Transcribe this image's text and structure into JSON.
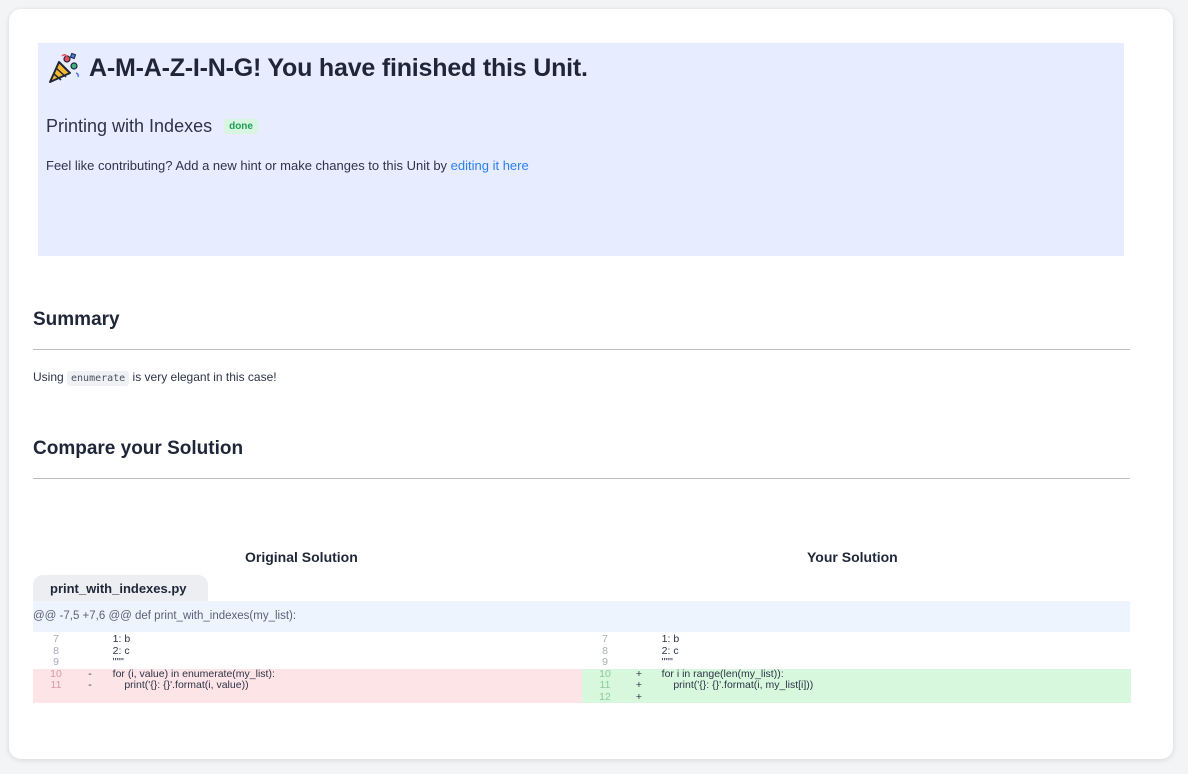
{
  "banner": {
    "title": "A-M-A-Z-I-N-G! You have finished this Unit.",
    "unit_name": "Printing with Indexes",
    "status_badge": "done",
    "contrib_text": "Feel like contributing? Add a new hint or make changes to this Unit by ",
    "contrib_link": "editing it here"
  },
  "summary": {
    "heading": "Summary",
    "text_before": "Using ",
    "code": "enumerate",
    "text_after": " is very elegant in this case!"
  },
  "compare": {
    "heading": "Compare your Solution",
    "original_heading": "Original Solution",
    "yours_heading": "Your Solution",
    "file_name": "print_with_indexes.py",
    "hunk_header": "@@ -7,5 +7,6 @@ def print_with_indexes(my_list):",
    "left_lines": [
      {
        "ln": "7",
        "sign": "",
        "code": "    1: b",
        "type": "ctx"
      },
      {
        "ln": "8",
        "sign": "",
        "code": "    2: c",
        "type": "ctx"
      },
      {
        "ln": "9",
        "sign": "",
        "code": "    \"\"\"",
        "type": "ctx"
      },
      {
        "ln": "10",
        "sign": "-",
        "code": "    for (i, value) in enumerate(my_list):",
        "type": "del"
      },
      {
        "ln": "11",
        "sign": "-",
        "code": "        print('{}: {}'.format(i, value))",
        "type": "del"
      }
    ],
    "right_lines": [
      {
        "ln": "7",
        "sign": "",
        "code": "    1: b",
        "type": "ctx"
      },
      {
        "ln": "8",
        "sign": "",
        "code": "    2: c",
        "type": "ctx"
      },
      {
        "ln": "9",
        "sign": "",
        "code": "    \"\"\"",
        "type": "ctx"
      },
      {
        "ln": "10",
        "sign": "+",
        "code": "    for i in range(len(my_list)):",
        "type": "add"
      },
      {
        "ln": "11",
        "sign": "+",
        "code": "        print('{}: {}'.format(i, my_list[i]))",
        "type": "add"
      },
      {
        "ln": "12",
        "sign": "+",
        "code": "",
        "type": "add"
      }
    ]
  },
  "colors": {
    "banner_bg": "#e7edfe",
    "link": "#2d7ff0",
    "deleted_bg": "#fde4e6",
    "added_bg": "#d7f8dd",
    "hunk_bg": "#edf4fe"
  },
  "icons": {
    "celebration": "party-popper-icon"
  }
}
